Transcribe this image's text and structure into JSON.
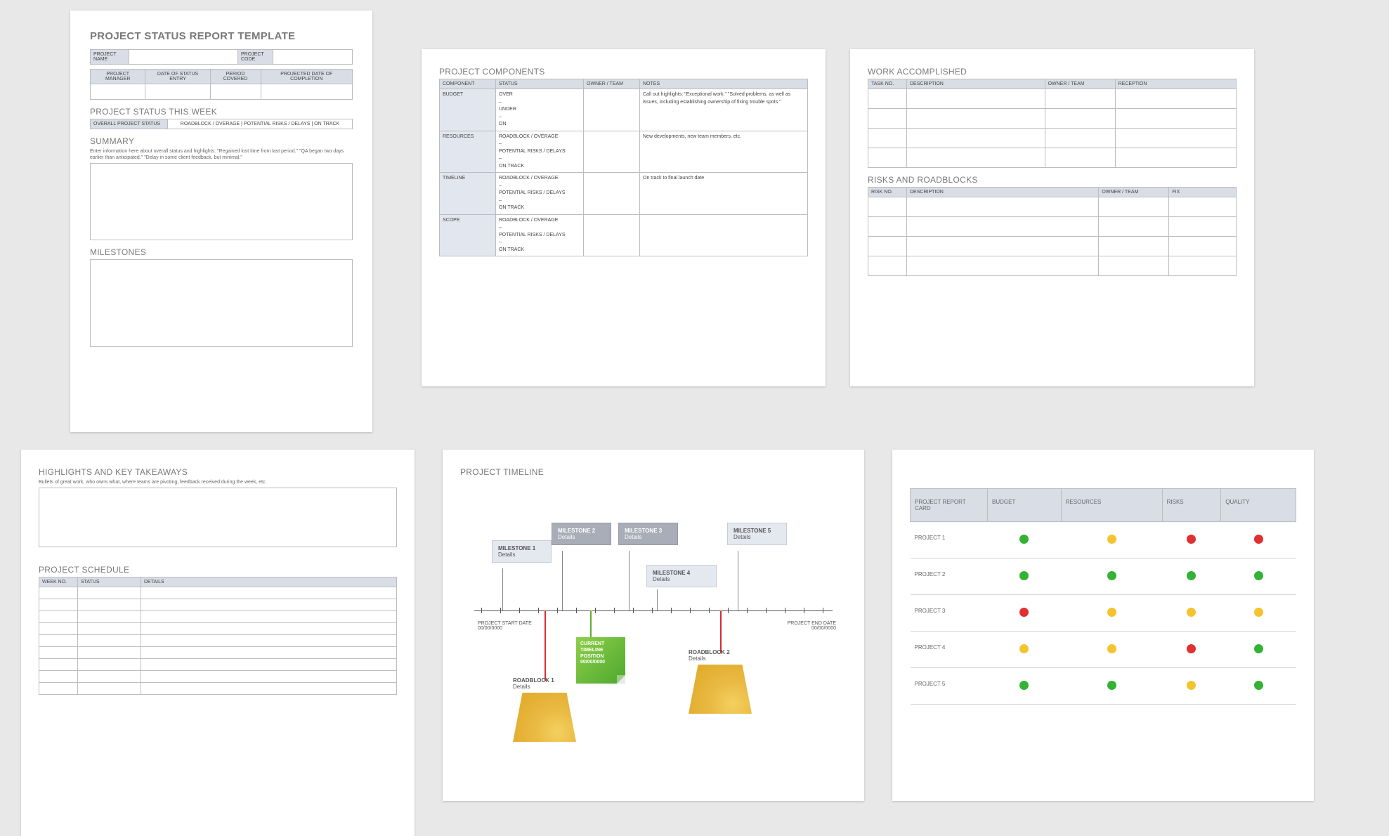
{
  "p1": {
    "title": "PROJECT STATUS REPORT TEMPLATE",
    "fields": {
      "name": "PROJECT NAME",
      "code": "PROJECT CODE",
      "manager": "PROJECT MANAGER",
      "entry": "DATE OF STATUS ENTRY",
      "period": "PERIOD COVERED",
      "proj": "PROJECTED DATE OF COMPLETION"
    },
    "week_title": "PROJECT STATUS THIS WEEK",
    "status_label": "OVERALL PROJECT STATUS",
    "status_opts": "ROADBLOCK / OVERAGE   |   POTENTIAL RISKS / DELAYS   |   ON TRACK",
    "summary_title": "SUMMARY",
    "summary_hint": "Enter information here about overall status and highlights: \"Regained lost time from last period.\" \"QA began two days earlier than anticipated.\" \"Delay in some client feedback, but minimal.\"",
    "milestones_title": "MILESTONES"
  },
  "p2": {
    "title": "PROJECT COMPONENTS",
    "head": {
      "c": "COMPONENT",
      "s": "STATUS",
      "o": "OWNER / TEAM",
      "n": "NOTES"
    },
    "rows": [
      {
        "c": "BUDGET",
        "s": "OVER\n–\nUNDER\n–\nON",
        "n": "Call out highlights:  \"Exceptional work.\"  \"Solved problems, as well as issues, including establishing ownership of fixing trouble spots.\""
      },
      {
        "c": "RESOURCES",
        "s": "ROADBLOCK / OVERAGE\n–\nPOTENTIAL RISKS / DELAYS\n–\nON TRACK",
        "n": "New developments, new team members, etc."
      },
      {
        "c": "TIMELINE",
        "s": "ROADBLOCK / OVERAGE\n–\nPOTENTIAL RISKS / DELAYS\n–\nON TRACK",
        "n": "On track to final launch date"
      },
      {
        "c": "SCOPE",
        "s": "ROADBLOCK / OVERAGE\n–\nPOTENTIAL RISKS / DELAYS\n–\nON TRACK",
        "n": ""
      }
    ]
  },
  "p3": {
    "wa_title": "WORK ACCOMPLISHED",
    "wa_head": {
      "t": "TASK NO.",
      "d": "DESCRIPTION",
      "o": "OWNER / TEAM",
      "r": "RECEPTION"
    },
    "rr_title": "RISKS AND ROADBLOCKS",
    "rr_head": {
      "r": "RISK NO.",
      "d": "DESCRIPTION",
      "o": "OWNER / TEAM",
      "f": "FIX"
    }
  },
  "p4": {
    "hk_title": "HIGHLIGHTS AND KEY TAKEAWAYS",
    "hk_hint": "Bullets of great work, who owns what, where teams are pivoting, feedback received during the week, etc.",
    "ps_title": "PROJECT SCHEDULE",
    "ps_head": {
      "w": "WEEK NO.",
      "s": "STATUS",
      "d": "DETAILS"
    }
  },
  "p5": {
    "title": "PROJECT TIMELINE",
    "start": {
      "l": "PROJECT START DATE",
      "d": "00/00/0000"
    },
    "end": {
      "l": "PROJECT END DATE",
      "d": "00/00/0000"
    },
    "miles": [
      {
        "t": "MILESTONE 1",
        "d": "Details"
      },
      {
        "t": "MILESTONE 2",
        "d": "Details"
      },
      {
        "t": "MILESTONE 3",
        "d": "Details"
      },
      {
        "t": "MILESTONE 4",
        "d": "Details"
      },
      {
        "t": "MILESTONE 5",
        "d": "Details"
      }
    ],
    "rb1": {
      "t": "ROADBLOCK 1",
      "d": "Details"
    },
    "rb2": {
      "t": "ROADBLOCK 2",
      "d": "Details"
    },
    "cur": {
      "l1": "CURRENT",
      "l2": "TIMELINE",
      "l3": "POSITION",
      "d": "00/00/0000"
    }
  },
  "p6": {
    "head": {
      "p": "PROJECT REPORT CARD",
      "b": "BUDGET",
      "r": "RESOURCES",
      "k": "RISKS",
      "q": "QUALITY"
    },
    "rows": [
      {
        "n": "PROJECT 1",
        "c": [
          "g",
          "y",
          "r",
          "r"
        ]
      },
      {
        "n": "PROJECT 2",
        "c": [
          "g",
          "g",
          "g",
          "g"
        ]
      },
      {
        "n": "PROJECT 3",
        "c": [
          "r",
          "y",
          "y",
          "y"
        ]
      },
      {
        "n": "PROJECT 4",
        "c": [
          "y",
          "y",
          "r",
          "g"
        ]
      },
      {
        "n": "PROJECT 5",
        "c": [
          "g",
          "g",
          "y",
          "g"
        ]
      }
    ]
  }
}
